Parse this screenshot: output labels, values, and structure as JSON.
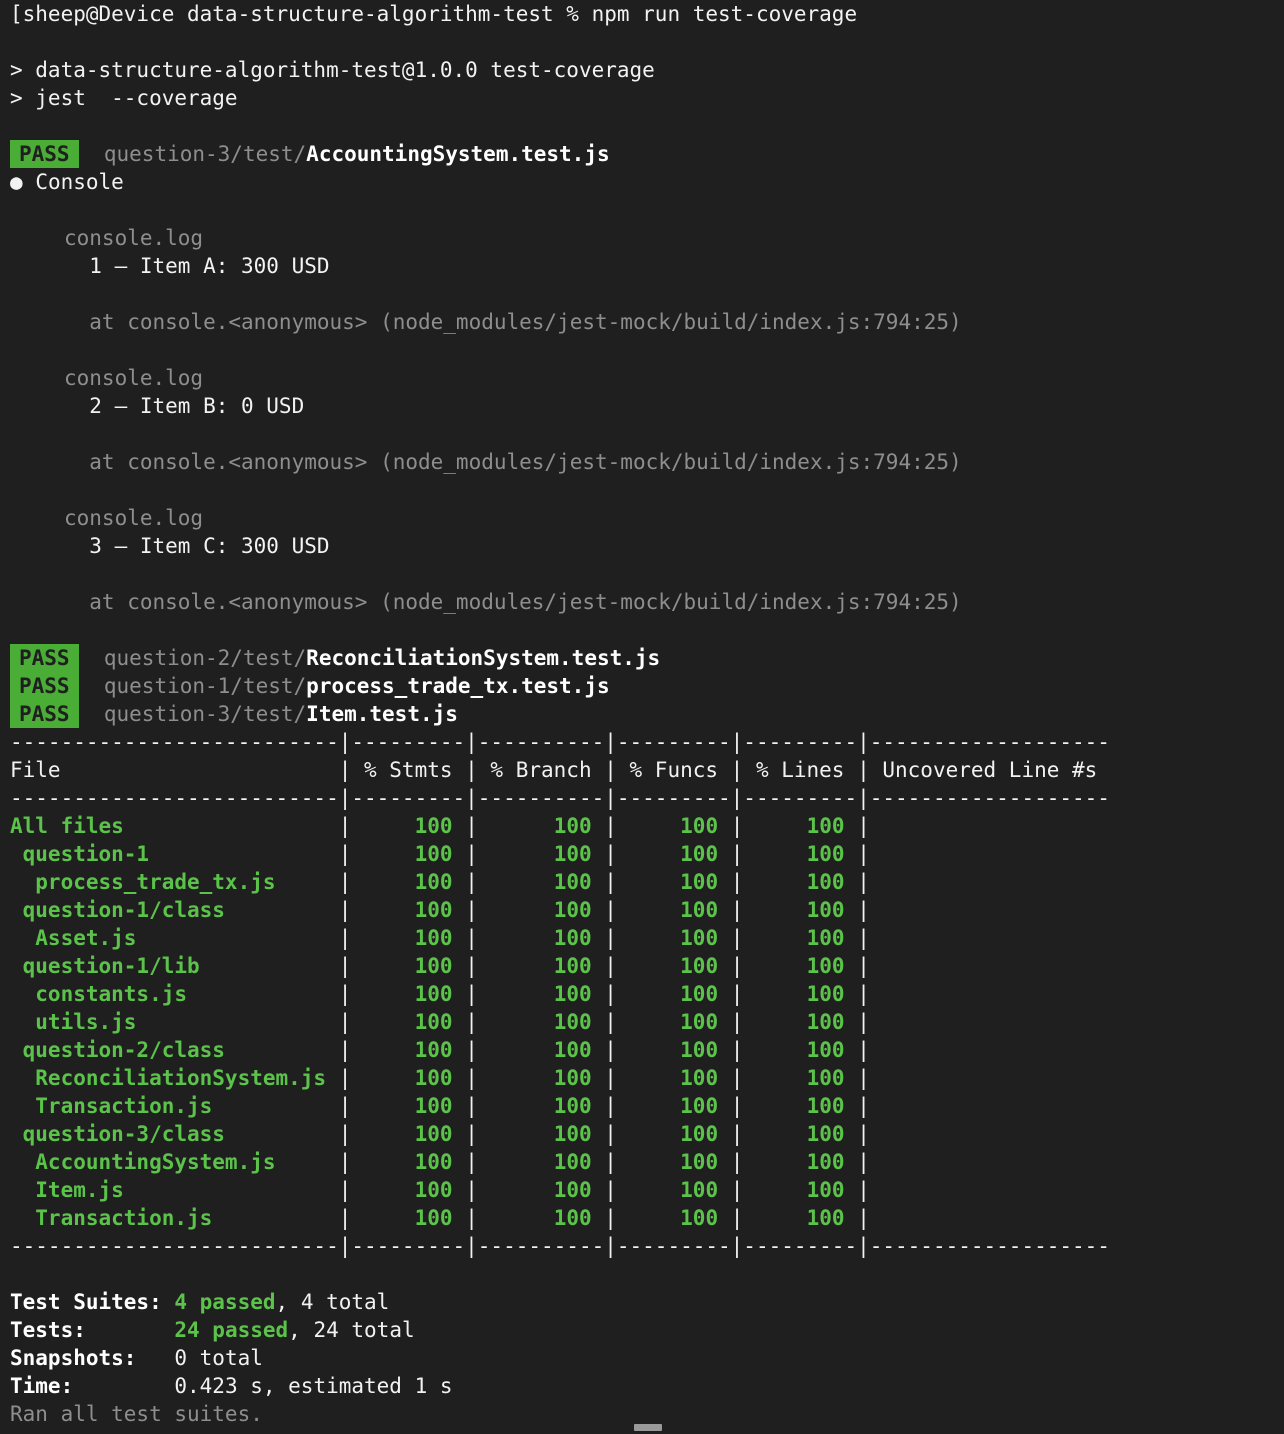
{
  "terminal": {
    "bg_color": "#1f1f1f",
    "fg_color": "#e6e6e6",
    "dim_color": "#8e8e8e",
    "green_color": "#5bc24a",
    "badge_bg_color": "#4aad35",
    "prompt_line": "[sheep@Device data-structure-algorithm-test % npm run test-coverage",
    "npm_header_1": "> data-structure-algorithm-test@1.0.0 test-coverage",
    "npm_header_2": "> jest  --coverage"
  },
  "suites": {
    "first": {
      "badge": "PASS",
      "path": "question-3/test/",
      "file": "AccountingSystem.test.js",
      "console_label": "Console",
      "bullet": "●"
    },
    "rest": [
      {
        "badge": "PASS",
        "path": "question-2/test/",
        "file": "ReconciliationSystem.test.js"
      },
      {
        "badge": "PASS",
        "path": "question-1/test/",
        "file": "process_trade_tx.test.js"
      },
      {
        "badge": "PASS",
        "path": "question-3/test/",
        "file": "Item.test.js"
      }
    ]
  },
  "console_logs": [
    {
      "label": "console.log",
      "message": "  1 – Item A: 300 USD",
      "trace": "  at console.<anonymous> (node_modules/jest-mock/build/index.js:794:25)"
    },
    {
      "label": "console.log",
      "message": "  2 – Item B: 0 USD",
      "trace": "  at console.<anonymous> (node_modules/jest-mock/build/index.js:794:25)"
    },
    {
      "label": "console.log",
      "message": "  3 – Item C: 300 USD",
      "trace": "  at console.<anonymous> (node_modules/jest-mock/build/index.js:794:25)"
    }
  ],
  "coverage_table": {
    "separator": "--------------------------|---------|----------|---------|---------|-------------------",
    "header": "File                      | % Stmts | % Branch | % Funcs | % Lines | Uncovered Line #s ",
    "columns": [
      "File",
      "% Stmts",
      "% Branch",
      "% Funcs",
      "% Lines",
      "Uncovered Line #s"
    ],
    "rows": [
      {
        "file": "All files",
        "indent": 0,
        "stmts": "100",
        "branch": "100",
        "funcs": "100",
        "lines": "100",
        "uncovered": ""
      },
      {
        "file": "question-1",
        "indent": 1,
        "stmts": "100",
        "branch": "100",
        "funcs": "100",
        "lines": "100",
        "uncovered": ""
      },
      {
        "file": "process_trade_tx.js",
        "indent": 2,
        "stmts": "100",
        "branch": "100",
        "funcs": "100",
        "lines": "100",
        "uncovered": ""
      },
      {
        "file": "question-1/class",
        "indent": 1,
        "stmts": "100",
        "branch": "100",
        "funcs": "100",
        "lines": "100",
        "uncovered": ""
      },
      {
        "file": "Asset.js",
        "indent": 2,
        "stmts": "100",
        "branch": "100",
        "funcs": "100",
        "lines": "100",
        "uncovered": ""
      },
      {
        "file": "question-1/lib",
        "indent": 1,
        "stmts": "100",
        "branch": "100",
        "funcs": "100",
        "lines": "100",
        "uncovered": ""
      },
      {
        "file": "constants.js",
        "indent": 2,
        "stmts": "100",
        "branch": "100",
        "funcs": "100",
        "lines": "100",
        "uncovered": ""
      },
      {
        "file": "utils.js",
        "indent": 2,
        "stmts": "100",
        "branch": "100",
        "funcs": "100",
        "lines": "100",
        "uncovered": ""
      },
      {
        "file": "question-2/class",
        "indent": 1,
        "stmts": "100",
        "branch": "100",
        "funcs": "100",
        "lines": "100",
        "uncovered": ""
      },
      {
        "file": "ReconciliationSystem.js",
        "indent": 2,
        "stmts": "100",
        "branch": "100",
        "funcs": "100",
        "lines": "100",
        "uncovered": ""
      },
      {
        "file": "Transaction.js",
        "indent": 2,
        "stmts": "100",
        "branch": "100",
        "funcs": "100",
        "lines": "100",
        "uncovered": ""
      },
      {
        "file": "question-3/class",
        "indent": 1,
        "stmts": "100",
        "branch": "100",
        "funcs": "100",
        "lines": "100",
        "uncovered": ""
      },
      {
        "file": "AccountingSystem.js",
        "indent": 2,
        "stmts": "100",
        "branch": "100",
        "funcs": "100",
        "lines": "100",
        "uncovered": ""
      },
      {
        "file": "Item.js",
        "indent": 2,
        "stmts": "100",
        "branch": "100",
        "funcs": "100",
        "lines": "100",
        "uncovered": ""
      },
      {
        "file": "Transaction.js",
        "indent": 2,
        "stmts": "100",
        "branch": "100",
        "funcs": "100",
        "lines": "100",
        "uncovered": ""
      }
    ]
  },
  "summary": {
    "test_suites_label": "Test Suites: ",
    "test_suites_passed": "4 passed",
    "test_suites_rest": ", 4 total",
    "tests_label": "Tests:       ",
    "tests_passed": "24 passed",
    "tests_rest": ", 24 total",
    "snapshots_label": "Snapshots:   ",
    "snapshots_value": "0 total",
    "time_label": "Time:        ",
    "time_value": "0.423 s, estimated 1 s",
    "ran_all": "Ran all test suites."
  }
}
